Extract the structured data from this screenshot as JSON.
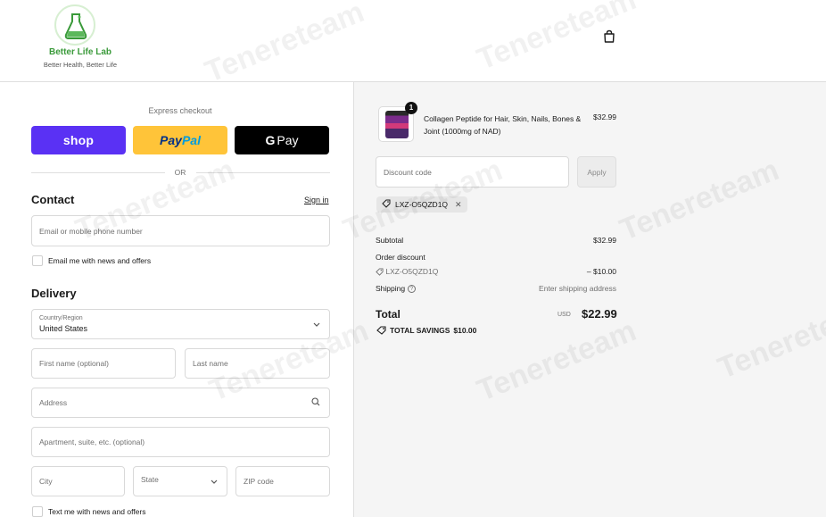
{
  "brand": {
    "name": "Better Life Lab",
    "tagline": "Better Health, Better Life"
  },
  "express": {
    "title": "Express checkout",
    "buttons": {
      "shop": "shop",
      "paypal_1": "Pay",
      "paypal_2": "Pal",
      "gpay_g": "G",
      "gpay_text": "Pay"
    },
    "or_text": "OR"
  },
  "contact": {
    "title": "Contact",
    "signin": "Sign in",
    "email_placeholder": "Email or mobile phone number",
    "news_offers": "Email me with news and offers"
  },
  "delivery": {
    "title": "Delivery",
    "country_label": "Country/Region",
    "country_value": "United States",
    "first_name": "First name (optional)",
    "last_name": "Last name",
    "address": "Address",
    "apartment": "Apartment, suite, etc. (optional)",
    "city": "City",
    "state": "State",
    "zip": "ZIP code",
    "text_offers": "Text me with news and offers"
  },
  "order": {
    "product_name": "Collagen Peptide for Hair, Skin, Nails, Bones & Joint (1000mg of NAD)",
    "product_price": "$32.99",
    "quantity": "1",
    "discount_placeholder": "Discount code",
    "apply_label": "Apply",
    "applied_code": "LXZ-O5QZD1Q",
    "subtotal_label": "Subtotal",
    "subtotal_value": "$32.99",
    "order_discount_label": "Order discount",
    "discount_code": "LXZ-O5QZD1Q",
    "discount_value": "– $10.00",
    "shipping_label": "Shipping",
    "shipping_value": "Enter shipping address",
    "total_label": "Total",
    "currency": "USD",
    "total_value": "$22.99",
    "savings_label": "TOTAL SAVINGS",
    "savings_value": "$10.00"
  },
  "watermark": "Tenereteam",
  "icons": [
    "flask-logo-icon",
    "cart-icon",
    "chevron-down-icon",
    "search-icon",
    "tag-icon",
    "close-icon",
    "help-icon"
  ],
  "colors": {
    "shop": "#5a31f4",
    "paypal": "#ffc439",
    "gpay": "#000000",
    "brand_green": "#3a9a3a",
    "summary_bg": "#f5f5f5"
  }
}
